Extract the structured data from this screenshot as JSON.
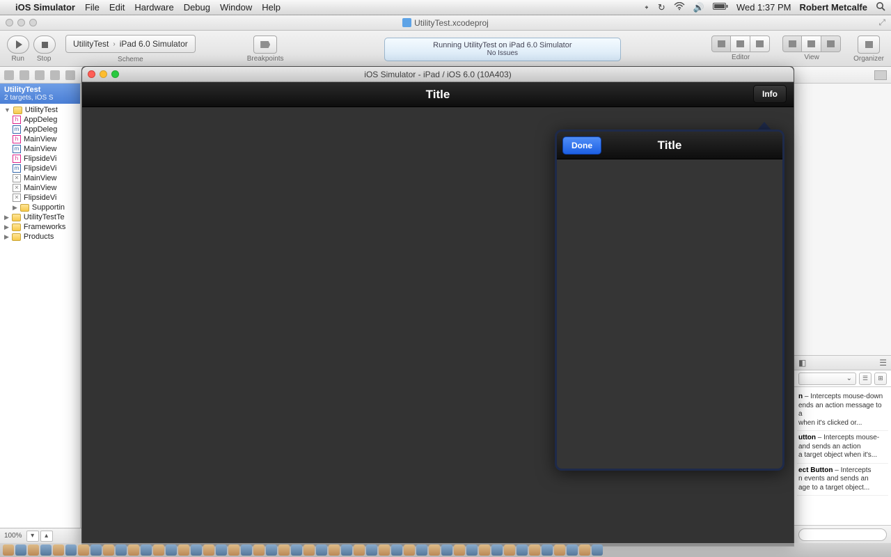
{
  "menubar": {
    "app": "iOS Simulator",
    "items": [
      "File",
      "Edit",
      "Hardware",
      "Debug",
      "Window",
      "Help"
    ],
    "status_time": "Wed 1:37 PM",
    "user": "Robert Metcalfe"
  },
  "xcode": {
    "window_title": "UtilityTest.xcodeproj",
    "toolbar": {
      "run_label": "Run",
      "stop_label": "Stop",
      "scheme_name": "UtilityTest",
      "scheme_dest": "iPad 6.0 Simulator",
      "scheme_label": "Scheme",
      "breakpoints_label": "Breakpoints",
      "editor_label": "Editor",
      "view_label": "View",
      "organizer_label": "Organizer"
    },
    "activity": {
      "line1": "Running UtilityTest on iPad 6.0 Simulator",
      "line2": "No Issues"
    },
    "navigator": {
      "project": "UtilityTest",
      "subtitle": "2 targets, iOS S",
      "tree": [
        {
          "kind": "folder",
          "label": "UtilityTest",
          "open": true,
          "indent": 0
        },
        {
          "kind": "h",
          "label": "AppDeleg",
          "indent": 1
        },
        {
          "kind": "m",
          "label": "AppDeleg",
          "indent": 1
        },
        {
          "kind": "h",
          "label": "MainView",
          "indent": 1
        },
        {
          "kind": "m",
          "label": "MainView",
          "indent": 1
        },
        {
          "kind": "h",
          "label": "FlipsideVi",
          "indent": 1
        },
        {
          "kind": "m",
          "label": "FlipsideVi",
          "indent": 1
        },
        {
          "kind": "x",
          "label": "MainView",
          "indent": 1
        },
        {
          "kind": "x",
          "label": "MainView",
          "indent": 1
        },
        {
          "kind": "x",
          "label": "FlipsideVi",
          "indent": 1
        },
        {
          "kind": "folder",
          "label": "Supportin",
          "open": false,
          "indent": 1
        },
        {
          "kind": "folder",
          "label": "UtilityTestTe",
          "open": false,
          "indent": 0
        },
        {
          "kind": "folder",
          "label": "Frameworks",
          "open": false,
          "indent": 0
        },
        {
          "kind": "folder",
          "label": "Products",
          "open": false,
          "indent": 0
        }
      ]
    },
    "library": [
      {
        "t": "n",
        "b": " – Intercepts mouse-down ",
        "r": "ends an action message to a",
        "r2": "when it's clicked or..."
      },
      {
        "t": "utton",
        "b": " – Intercepts mouse-",
        "r": "and sends an action",
        "r2": "a target object when it's..."
      },
      {
        "t": "ect Button",
        "b": " – Intercepts",
        "r": "n events and sends an",
        "r2": "age to a target object..."
      }
    ],
    "zoom": "100%"
  },
  "simulator": {
    "window_title": "iOS Simulator - iPad / iOS 6.0 (10A403)",
    "main_title": "Title",
    "info_label": "Info",
    "popover_title": "Title",
    "done_label": "Done"
  }
}
